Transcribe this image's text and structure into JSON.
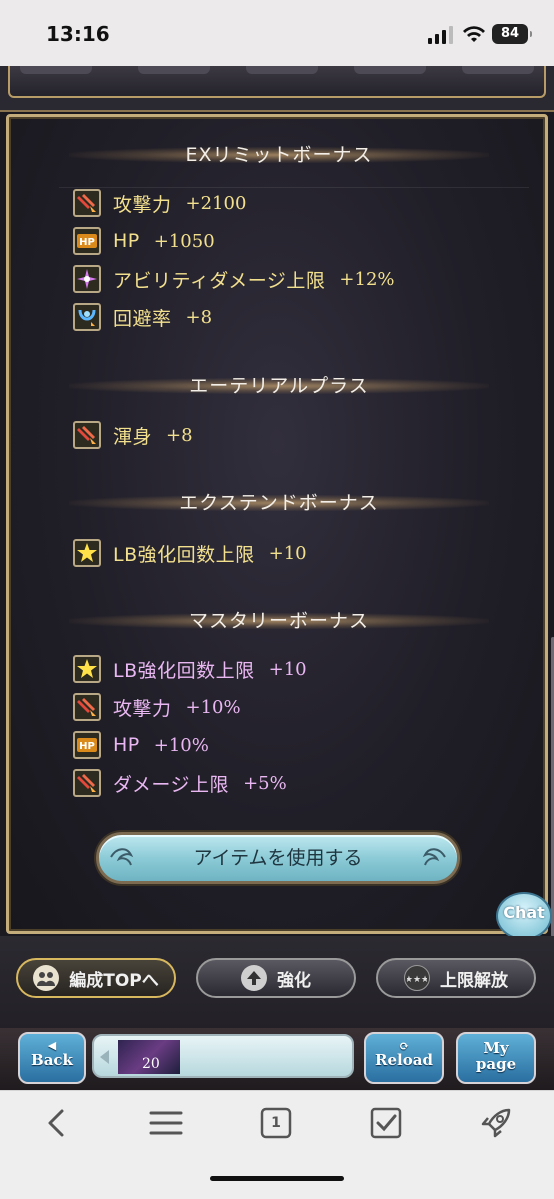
{
  "status_bar": {
    "time": "13:16",
    "battery": "84"
  },
  "sections": [
    {
      "title": "EXリミットボーナス",
      "color": "yellow",
      "items": [
        {
          "icon": "atk-up-icon",
          "label": "攻撃力",
          "value": "+2100"
        },
        {
          "icon": "hp-up-icon",
          "label": "HP",
          "value": "+1050"
        },
        {
          "icon": "ability-damage-icon",
          "label": "アビリティダメージ上限",
          "value": "+12%"
        },
        {
          "icon": "evasion-icon",
          "label": "回避率",
          "value": "+8"
        }
      ]
    },
    {
      "title": "エーテリアルプラス",
      "color": "yellow",
      "items": [
        {
          "icon": "atk-up-icon",
          "label": "渾身",
          "value": "+8"
        }
      ]
    },
    {
      "title": "エクステンドボーナス",
      "color": "yellow",
      "items": [
        {
          "icon": "star-icon",
          "label": "LB強化回数上限",
          "value": "+10"
        }
      ]
    },
    {
      "title": "マスタリーボーナス",
      "color": "purple",
      "items": [
        {
          "icon": "star-icon",
          "label": "LB強化回数上限",
          "value": "+10"
        },
        {
          "icon": "atk-up-icon",
          "label": "攻撃力",
          "value": "+10%"
        },
        {
          "icon": "hp-up-icon",
          "label": "HP",
          "value": "+10%"
        },
        {
          "icon": "atk-up-icon",
          "label": "ダメージ上限",
          "value": "+5%"
        }
      ]
    }
  ],
  "use_item_button": "アイテムを使用する",
  "chat_button": "Chat",
  "bottom_tabs": {
    "party_top": "編成TOPへ",
    "enhance": "強化",
    "uncap": "上限解放"
  },
  "nav_bar": {
    "back": "Back",
    "reload": "Reload",
    "my_page_1": "My",
    "my_page_2": "page",
    "slot_count": "20"
  },
  "safari": {
    "tab_count": "1"
  },
  "colors": {
    "gold": "#f2e08e",
    "purple": "#e9b7f2",
    "accent_frame": "#c5ad7b"
  }
}
